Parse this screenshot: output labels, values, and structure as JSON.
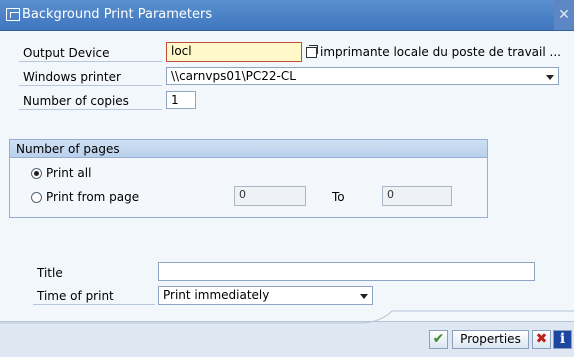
{
  "window": {
    "title": "Background Print Parameters",
    "close_glyph": "✕"
  },
  "form": {
    "output_device": {
      "label": "Output Device",
      "value": "locl",
      "description": "imprimante locale du poste de travail ..."
    },
    "windows_printer": {
      "label": "Windows printer",
      "value": "\\\\carnvps01\\PC22-CL"
    },
    "copies": {
      "label": "Number of copies",
      "value": "1"
    }
  },
  "pages": {
    "title": "Number of pages",
    "print_all": "Print all",
    "print_from": "Print from page",
    "from_value": "0",
    "to_label": "To",
    "to_value": "0",
    "selected": "print_all"
  },
  "title_field": {
    "label": "Title",
    "value": ""
  },
  "time_of_print": {
    "label": "Time of print",
    "value": "Print immediately"
  },
  "buttons": {
    "confirm_icon": "✔",
    "properties": "Properties",
    "cancel_icon": "✖",
    "info_icon": "i"
  },
  "colors": {
    "title_bar": "#3f76bf",
    "background": "#f2f7fc",
    "focus_field": "#fff8c8",
    "cancel": "#c0201c",
    "confirm": "#3a8a24"
  }
}
